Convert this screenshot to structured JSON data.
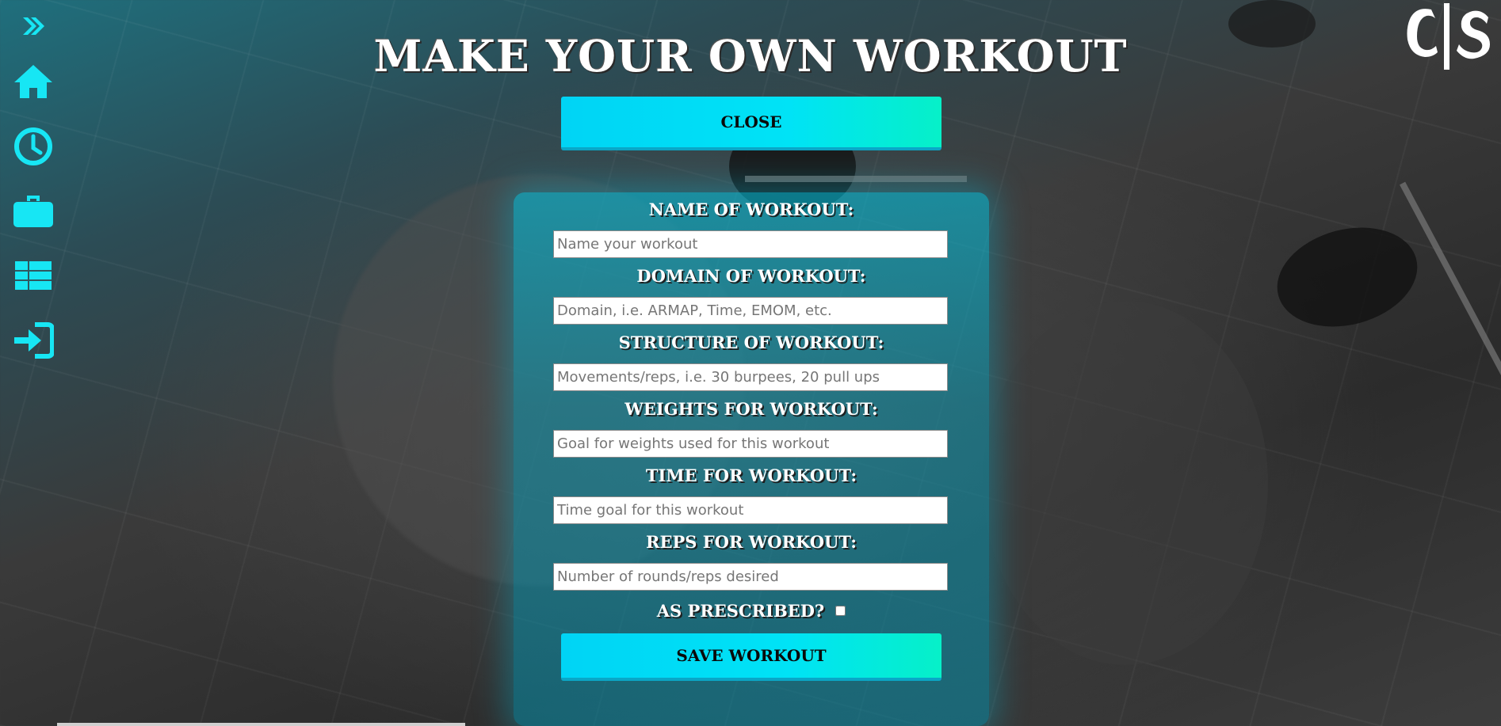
{
  "app": {
    "title": "Make Your Own Workout",
    "logo_text": "C|S"
  },
  "sidebar": {
    "items": [
      {
        "name": "expand",
        "icon": "double-chevron-right-icon"
      },
      {
        "name": "home",
        "icon": "home-icon"
      },
      {
        "name": "history",
        "icon": "clock-icon"
      },
      {
        "name": "workouts",
        "icon": "briefcase-icon"
      },
      {
        "name": "table",
        "icon": "table-icon"
      },
      {
        "name": "login",
        "icon": "sign-in-icon"
      }
    ],
    "accent_color": "#17e6f4"
  },
  "buttons": {
    "close_label": "Close",
    "save_label": "Save Workout",
    "gradient_start": "#00d4f5",
    "gradient_end": "#06f0c8"
  },
  "form": {
    "fields": [
      {
        "label": "Name of Workout:",
        "placeholder": "Name your workout",
        "value": ""
      },
      {
        "label": "Domain of Workout:",
        "placeholder": "Domain, i.e. ARMAP, Time, EMOM, etc.",
        "value": ""
      },
      {
        "label": "Structure of Workout:",
        "placeholder": "Movements/reps, i.e. 30 burpees, 20 pull ups",
        "value": ""
      },
      {
        "label": "Weights for Workout:",
        "placeholder": "Goal for weights used for this workout",
        "value": ""
      },
      {
        "label": "Time for Workout:",
        "placeholder": "Time goal for this workout",
        "value": ""
      },
      {
        "label": "Reps for Workout:",
        "placeholder": "Number of rounds/reps desired",
        "value": ""
      }
    ],
    "as_prescribed": {
      "label": "As Prescribed?",
      "checked": false
    }
  }
}
